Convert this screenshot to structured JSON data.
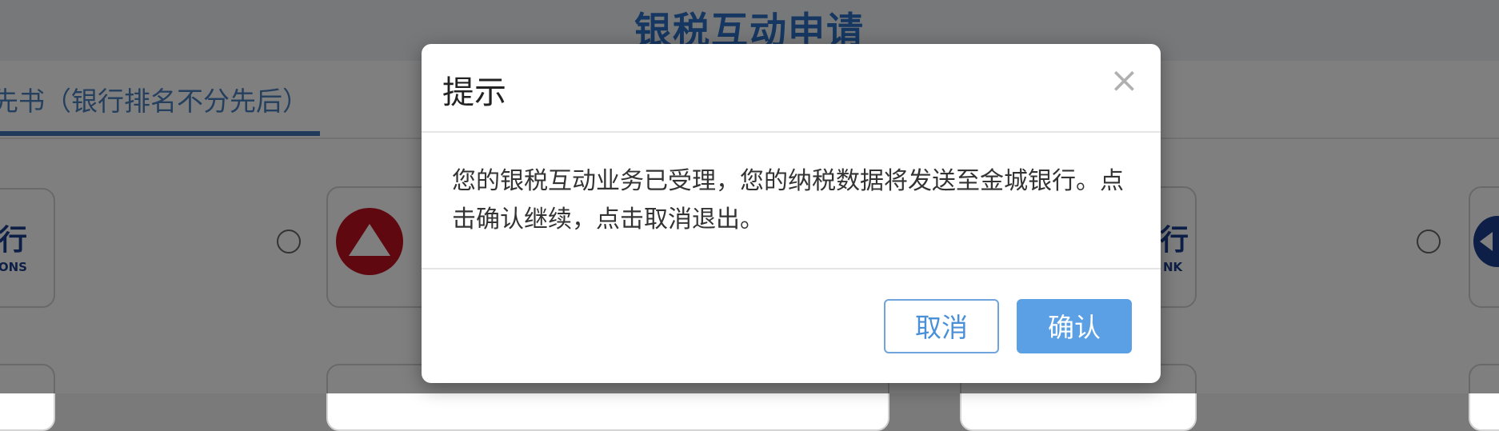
{
  "page": {
    "title": "银税互动申请",
    "active_tab": "先书（银行排名不分先后）",
    "banks": [
      {
        "text": "行",
        "sub": "TIONS"
      },
      {
        "text": "行",
        "sub": "NK"
      }
    ]
  },
  "dialog": {
    "title": "提示",
    "close_glyph": "×",
    "message": "您的银税互动业务已受理，您的纳税数据将发送至金城银行。点击确认继续，点击取消退出。",
    "cancel_label": "取消",
    "confirm_label": "确认"
  },
  "colors": {
    "accent": "#5b9fe4",
    "title_blue": "#2c6fc2",
    "overlay": "rgba(0,0,0,0.5)"
  },
  "icons": [
    "close-icon",
    "cmb-logo-icon",
    "boc-logo-icon"
  ]
}
